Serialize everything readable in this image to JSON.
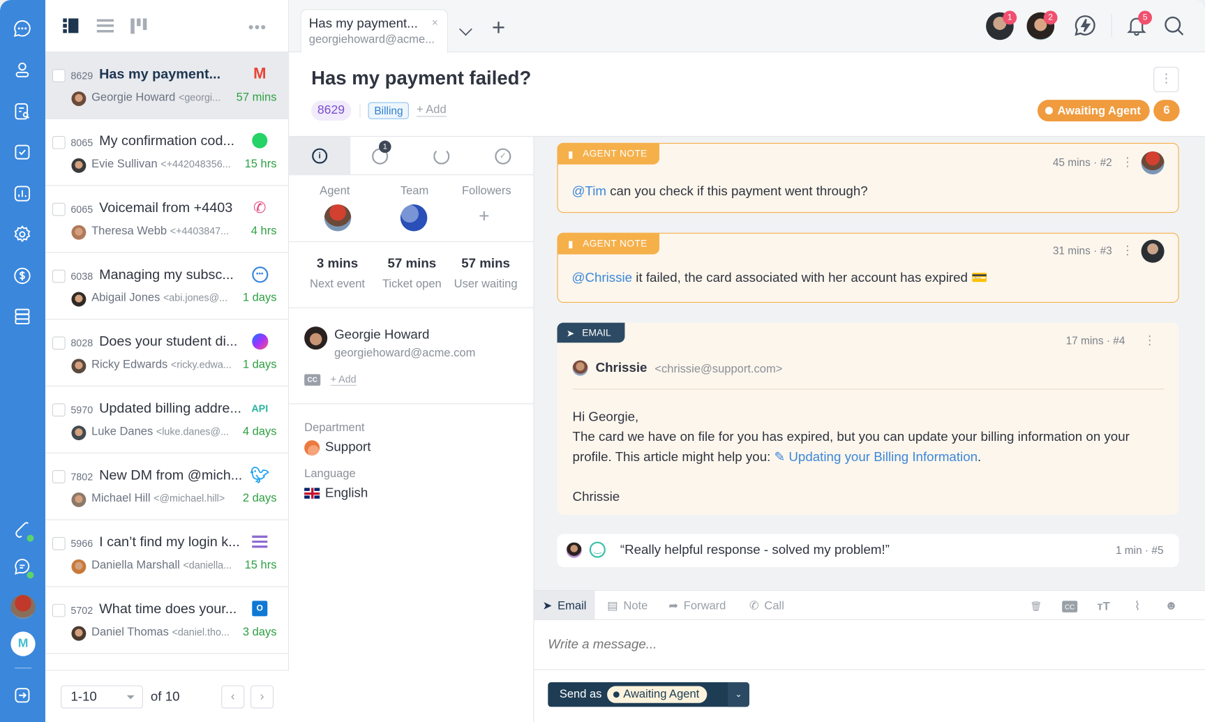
{
  "nav": {
    "items": [
      "chat-icon",
      "contacts-icon",
      "search-tickets-icon",
      "tasks-icon",
      "reports-icon",
      "settings-icon",
      "billing-icon",
      "database-icon",
      "phone-status-icon",
      "chat-status-icon",
      "user-avatar",
      "app-logo",
      "logout-icon"
    ]
  },
  "list": {
    "view_icons": [
      "split-view-icon",
      "list-view-icon",
      "board-view-icon"
    ],
    "tickets": [
      {
        "id": "8629",
        "subject": "Has my payment...",
        "name": "Georgie Howard",
        "contact": "<georgi...",
        "time": "57 mins",
        "channel": "gmail",
        "selected": true
      },
      {
        "id": "8065",
        "subject": "My confirmation cod...",
        "name": "Evie Sullivan",
        "contact": "<+442048356...",
        "time": "15 hrs",
        "channel": "whatsapp"
      },
      {
        "id": "6065",
        "subject": "Voicemail from +4403",
        "name": "Theresa Webb",
        "contact": "<+4403847...",
        "time": "4 hrs",
        "channel": "phone"
      },
      {
        "id": "6038",
        "subject": "Managing my subsc...",
        "name": "Abigail Jones",
        "contact": "<abi.jones@...",
        "time": "1 days",
        "channel": "chat"
      },
      {
        "id": "8028",
        "subject": "Does your student di...",
        "name": "Ricky Edwards",
        "contact": "<ricky.edwa...",
        "time": "1 days",
        "channel": "messenger"
      },
      {
        "id": "5970",
        "subject": "Updated billing addre...",
        "name": "Luke Danes",
        "contact": "<luke.danes@...",
        "time": "4 days",
        "channel": "API"
      },
      {
        "id": "7802",
        "subject": "New DM from @mich...",
        "name": "Michael Hill",
        "contact": "<@michael.hill>",
        "time": "2 days",
        "channel": "twitter"
      },
      {
        "id": "5966",
        "subject": "I can’t find my login k...",
        "name": "Daniella Marshall",
        "contact": "<daniella...",
        "time": "15 hrs",
        "channel": "form"
      },
      {
        "id": "5702",
        "subject": "What time does your...",
        "name": "Daniel Thomas",
        "contact": "<daniel.tho...",
        "time": "3 days",
        "channel": "outlook"
      }
    ],
    "pagination": {
      "range": "1-10",
      "of": "of 10"
    }
  },
  "tab": {
    "title": "Has my payment...",
    "subtitle": "georgiehoward@acme...",
    "close": "×"
  },
  "topbar": {
    "badges": [
      "1",
      "2"
    ],
    "notifications": "5"
  },
  "ticket": {
    "title": "Has my payment failed?",
    "id": "8629",
    "tag": "Billing",
    "add_tag": "+ Add",
    "status": "Awaiting Agent",
    "count": "6",
    "status_color": "#f09b3e"
  },
  "side": {
    "tab_badge": "1",
    "agent_label": "Agent",
    "team_label": "Team",
    "followers_label": "Followers",
    "followers_add": "+",
    "stats": [
      {
        "value": "3 mins",
        "label": "Next event"
      },
      {
        "value": "57 mins",
        "label": "Ticket open"
      },
      {
        "value": "57 mins",
        "label": "User waiting"
      }
    ],
    "contact": {
      "name": "Georgie Howard",
      "email": "georgiehoward@acme.com",
      "cc": "CC",
      "cc_add": "+ Add"
    },
    "department_label": "Department",
    "department": "Support",
    "language_label": "Language",
    "language": "English"
  },
  "messages": [
    {
      "type": "AGENT NOTE",
      "time": "45 mins",
      "num": "#2",
      "mention": "@Tim",
      "text": " can you check if this payment went through?"
    },
    {
      "type": "AGENT NOTE",
      "time": "31 mins",
      "num": "#3",
      "mention": "@Chrissie",
      "text": " it failed, the card associated with her account has expired 💳"
    },
    {
      "type": "EMAIL",
      "time": "17 mins",
      "num": "#4",
      "from_name": "Chrissie",
      "from_email": "<chrissie@support.com>",
      "greeting": "Hi Georgie,",
      "body": "The card we have on file for you has expired, but you can update your billing information on your profile. This article might help you: ",
      "link": "Updating your Billing Information",
      "after_link": ".",
      "signature": "Chrissie"
    },
    {
      "type": "rating",
      "text": "“Really helpful response - solved my problem!”",
      "time": "1 min",
      "num": "#5"
    }
  ],
  "composer": {
    "tabs": [
      "Email",
      "Note",
      "Forward",
      "Call"
    ],
    "placeholder": "Write a message...",
    "send_as": "Send as",
    "send_status": "Awaiting Agent"
  }
}
